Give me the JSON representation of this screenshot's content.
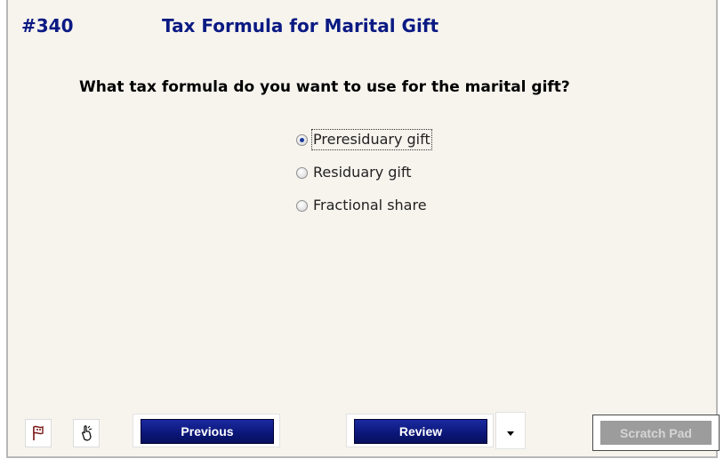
{
  "header": {
    "number": "#340",
    "title": "Tax Formula for Marital Gift"
  },
  "question": {
    "text": "What tax formula do you want to use for the marital gift?",
    "options": [
      {
        "label": "Preresiduary gift",
        "selected": true
      },
      {
        "label": "Residuary gift",
        "selected": false
      },
      {
        "label": "Fractional share",
        "selected": false
      }
    ]
  },
  "footer": {
    "flag_icon": "flag-icon",
    "hand_icon": "pointing-hand-icon",
    "previous_label": "Previous",
    "review_label": "Review",
    "scratch_pad_label": "Scratch Pad"
  },
  "colors": {
    "title": "#0b1a83",
    "button": "#0b1678",
    "background": "#f7f4ee",
    "disabled_button": "#9c9c9c"
  }
}
